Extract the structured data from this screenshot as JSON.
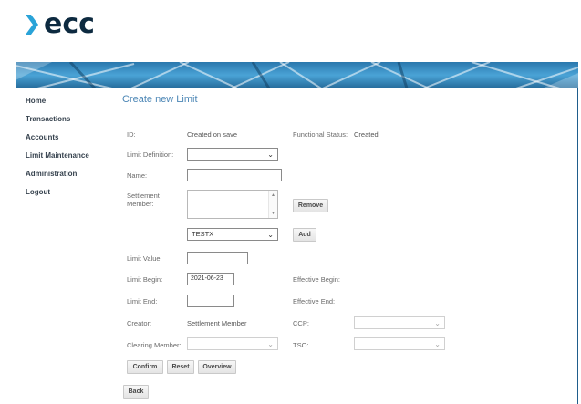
{
  "brand": {
    "logo_text": "ecc",
    "logo_color": "#0d2a40",
    "chevron_color": "#2aa3d8"
  },
  "sidebar": {
    "items": [
      {
        "label": "Home"
      },
      {
        "label": "Transactions"
      },
      {
        "label": "Accounts"
      },
      {
        "label": "Limit Maintenance"
      },
      {
        "label": "Administration"
      },
      {
        "label": "Logout"
      }
    ]
  },
  "page": {
    "title": "Create new Limit"
  },
  "form": {
    "id_label": "ID:",
    "id_value": "Created on save",
    "functional_status_label": "Functional Status:",
    "functional_status_value": "Created",
    "limit_definition_label": "Limit Definition:",
    "limit_definition_value": "",
    "name_label": "Name:",
    "name_value": "",
    "settlement_member_label_1": "Settlement",
    "settlement_member_label_2": "Member:",
    "remove_label": "Remove",
    "settlement_select_value": "TESTX",
    "add_label": "Add",
    "limit_value_label": "Limit Value:",
    "limit_value_value": "",
    "limit_begin_label": "Limit Begin:",
    "limit_begin_value": "2021-06-23",
    "effective_begin_label": "Effective Begin:",
    "limit_end_label": "Limit End:",
    "limit_end_value": "",
    "effective_end_label": "Effective End:",
    "creator_label": "Creator:",
    "creator_value": "Settlement Member",
    "ccp_label": "CCP:",
    "ccp_value": "",
    "clearing_member_label": "Clearing Member:",
    "clearing_member_value": "",
    "tso_label": "TSO:",
    "tso_value": ""
  },
  "buttons": {
    "confirm": "Confirm",
    "reset": "Reset",
    "overview": "Overview",
    "back": "Back"
  },
  "colors": {
    "accent": "#4d87b6",
    "banner": "#2a78ad",
    "frame": "#1f5d8c"
  },
  "icons": {
    "dropdown": "chevron-down-icon",
    "logo": "chevron-right-icon"
  }
}
